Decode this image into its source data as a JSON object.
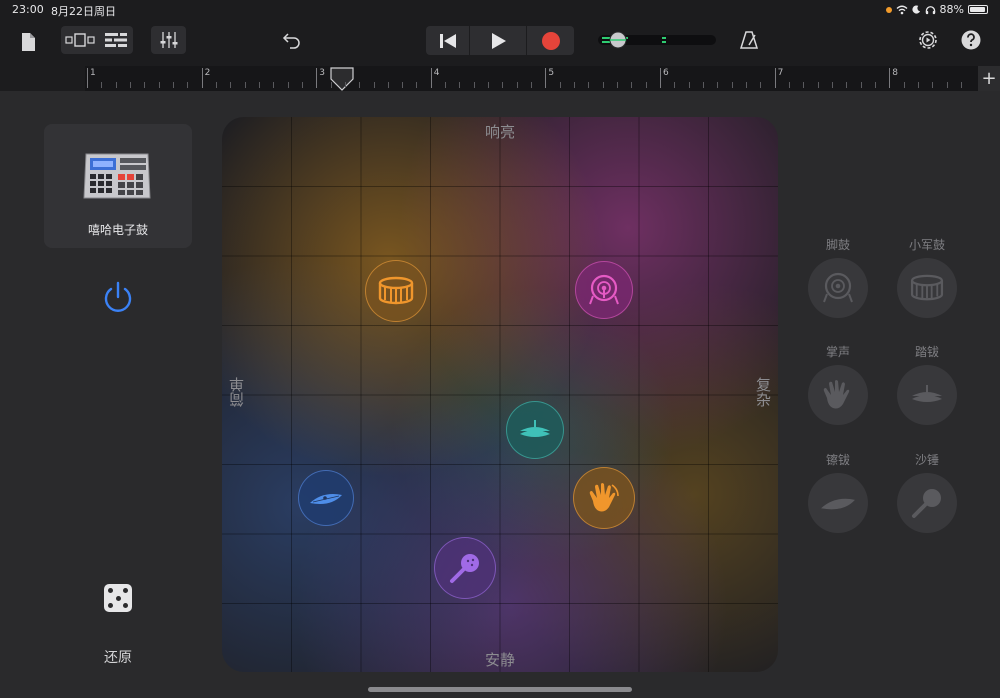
{
  "status": {
    "time": "23:00",
    "date": "8月22日周日",
    "battery": "88%"
  },
  "ruler": {
    "bars": [
      "1",
      "2",
      "3",
      "4",
      "5",
      "6",
      "7",
      "8"
    ],
    "add_symbol": "+"
  },
  "kit": {
    "name": "嘻哈电子鼓"
  },
  "reset": {
    "label": "还原"
  },
  "pad": {
    "axis_top": "响亮",
    "axis_bottom": "安静",
    "axis_left": "简单",
    "axis_right": "复杂"
  },
  "pucks": [
    {
      "name": "snare",
      "icon": "snare-drum-icon",
      "color": "#e8902a"
    },
    {
      "name": "kick",
      "icon": "kick-drum-icon",
      "color": "#d04fb4"
    },
    {
      "name": "hihat",
      "icon": "hihat-icon",
      "color": "#39b8b0"
    },
    {
      "name": "cymbal",
      "icon": "cymbal-icon",
      "color": "#4e8de8"
    },
    {
      "name": "clap",
      "icon": "hand-clap-icon",
      "color": "#e8902a"
    },
    {
      "name": "maracas",
      "icon": "maracas-icon",
      "color": "#9c63e0"
    }
  ],
  "instruments": [
    {
      "label": "脚鼓",
      "icon": "kick-drum-icon"
    },
    {
      "label": "小军鼓",
      "icon": "snare-drum-icon"
    },
    {
      "label": "掌声",
      "icon": "hand-clap-icon"
    },
    {
      "label": "踏钹",
      "icon": "hihat-icon"
    },
    {
      "label": "镲钹",
      "icon": "cymbal-icon"
    },
    {
      "label": "沙锤",
      "icon": "maracas-icon"
    }
  ],
  "colors": {
    "accent_blue": "#3b82f6",
    "record_red": "#e5443a",
    "meter_green": "#2ecc71"
  }
}
